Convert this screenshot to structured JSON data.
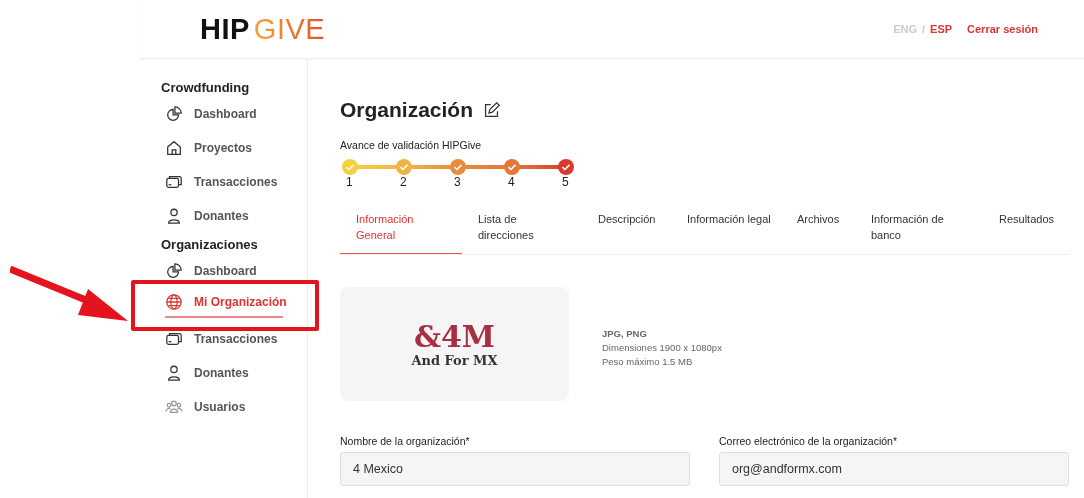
{
  "header": {
    "logo": {
      "part_1": "HIP",
      "part_2": "GIVE"
    },
    "languages": [
      {
        "label": "ENG",
        "selected": false
      },
      {
        "label": "ESP",
        "selected": true
      }
    ],
    "separator": "/",
    "logout": "Cerrar sesión"
  },
  "sidebar": {
    "sections": [
      {
        "title": "Crowdfunding",
        "items": [
          {
            "label": "Dashboard",
            "kind": "pie",
            "selected": false
          },
          {
            "label": "Proyectos",
            "kind": "house",
            "selected": false
          },
          {
            "label": "Transacciones",
            "kind": "card",
            "selected": false
          },
          {
            "label": "Donantes",
            "kind": "person",
            "selected": false
          }
        ]
      },
      {
        "title": "Organizaciones",
        "items": [
          {
            "label": "Dashboard",
            "kind": "pie",
            "selected": false
          },
          {
            "label": "Mi Organización",
            "kind": "globe",
            "selected": true
          },
          {
            "label": "Transacciones",
            "kind": "card",
            "selected": false
          },
          {
            "label": "Donantes",
            "kind": "person",
            "selected": false
          },
          {
            "label": "Usuarios",
            "kind": "users",
            "selected": false
          }
        ]
      }
    ]
  },
  "page": {
    "title": "Organización",
    "progress": {
      "label": "Avance de validación HIPGive",
      "steps": [
        {
          "label": "1",
          "done": true,
          "color": "#f5d142"
        },
        {
          "label": "2",
          "done": true,
          "color": "#eeb445"
        },
        {
          "label": "3",
          "done": true,
          "color": "#e98b3c"
        },
        {
          "label": "4",
          "done": true,
          "color": "#e4773a"
        },
        {
          "label": "5",
          "done": true,
          "color": "#d93a2f"
        }
      ]
    },
    "tabs": [
      {
        "label": "Información General",
        "selected": true
      },
      {
        "label": "Lista de direcciones",
        "selected": false
      },
      {
        "label": "Descripción",
        "selected": false
      },
      {
        "label": "Información legal",
        "selected": false
      },
      {
        "label": "Archivos",
        "selected": false
      },
      {
        "label": "Información de banco",
        "selected": false
      },
      {
        "label": "Resultados",
        "selected": false
      }
    ],
    "logo_upload": {
      "logo": {
        "line_1": "&4M",
        "line_2": "And For MX"
      },
      "formats": "JPG, PNG",
      "dimensions": "Dimensiones 1900 x 1080px",
      "max_size": "Peso máximo 1.5 MB"
    },
    "fields": [
      {
        "label": "Nombre de la organización*",
        "value": "4 Mexico"
      },
      {
        "label": "Correo electrónico de la organización*",
        "value": "org@andformx.com"
      }
    ]
  },
  "annotation": {
    "highlight": true
  }
}
